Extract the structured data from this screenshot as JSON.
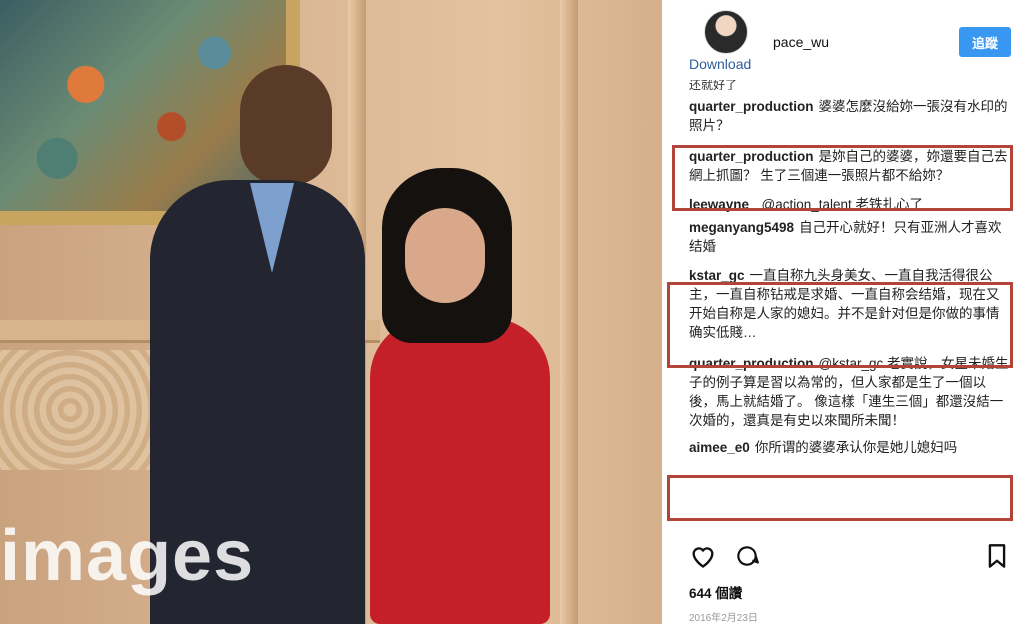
{
  "post": {
    "username": "pace_wu",
    "download_label": "Download",
    "follow_label": "追蹤",
    "photo_watermark": "images",
    "cut_text": "还就好了"
  },
  "comments": [
    {
      "user": "quarter_production",
      "text": "婆婆怎麼沒給妳一張沒有水印的照片？",
      "highlighted": false
    },
    {
      "user": "quarter_production",
      "text": "是妳自己的婆婆，妳還要自己去網上抓圖？ 生了三個連一張照片都不給妳？",
      "highlighted": true
    },
    {
      "user": "leewayne_",
      "text": "@action_talent 老铁扎心了",
      "highlighted": false
    },
    {
      "user": "meganyang5498",
      "text": "自己开心就好！只有亚洲人才喜欢结婚",
      "highlighted": false
    },
    {
      "user": "kstar_gc",
      "text": "一直自称九头身美女、一直自我活得很公主，一直自称钻戒是求婚、一直自称会结婚，现在又开始自称是人家的媳妇。并不是針对但是你做的事情确实低賤…",
      "highlighted": true
    },
    {
      "user": "quarter_production",
      "text": "@kstar_gc 老實說，女星未婚生子的例子算是習以為常的，但人家都是生了一個以後，馬上就結婚了。 像這樣「連生三個」都還沒結一次婚的，還真是有史以來聞所未聞！",
      "highlighted": false
    },
    {
      "user": "aimee_e0",
      "text": "你所谓的婆婆承认你是她儿媳妇吗",
      "highlighted": true
    }
  ],
  "footer": {
    "likes": "644 個讚",
    "date": "2016年2月23日"
  },
  "colors": {
    "follow_button": "#3897f0",
    "highlight_border": "#b3443a",
    "download_link": "#2f5d9a"
  },
  "icons": [
    "heart-icon",
    "comment-icon",
    "bookmark-icon"
  ]
}
